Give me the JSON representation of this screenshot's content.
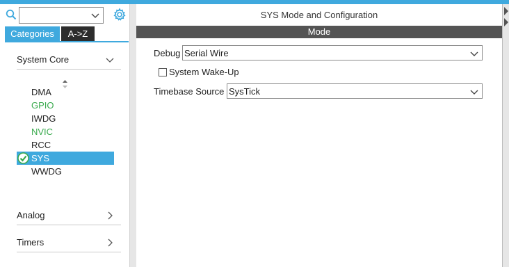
{
  "search": {
    "value": ""
  },
  "tabs": [
    {
      "label": "Categories",
      "active": true
    },
    {
      "label": "A->Z",
      "active": false
    }
  ],
  "categories": [
    {
      "label": "System Core",
      "expanded": true
    },
    {
      "label": "Analog",
      "expanded": false
    },
    {
      "label": "Timers",
      "expanded": false
    }
  ],
  "system_core_items": [
    {
      "label": "DMA",
      "state": "normal"
    },
    {
      "label": "GPIO",
      "state": "configured"
    },
    {
      "label": "IWDG",
      "state": "normal"
    },
    {
      "label": "NVIC",
      "state": "configured"
    },
    {
      "label": "RCC",
      "state": "normal"
    },
    {
      "label": "SYS",
      "state": "selected"
    },
    {
      "label": "WWDG",
      "state": "normal"
    }
  ],
  "panel": {
    "title": "SYS Mode and Configuration",
    "section": "Mode",
    "debug": {
      "label": "Debug",
      "value": "Serial Wire"
    },
    "wakeup": {
      "label": "System Wake-Up",
      "checked": false
    },
    "timebase": {
      "label": "Timebase Source",
      "value": "SysTick"
    }
  },
  "colors": {
    "accent": "#3fa9de",
    "configured": "#3aaa4e",
    "mode_bar": "#545454",
    "tab_inactive": "#2d2d2d"
  }
}
